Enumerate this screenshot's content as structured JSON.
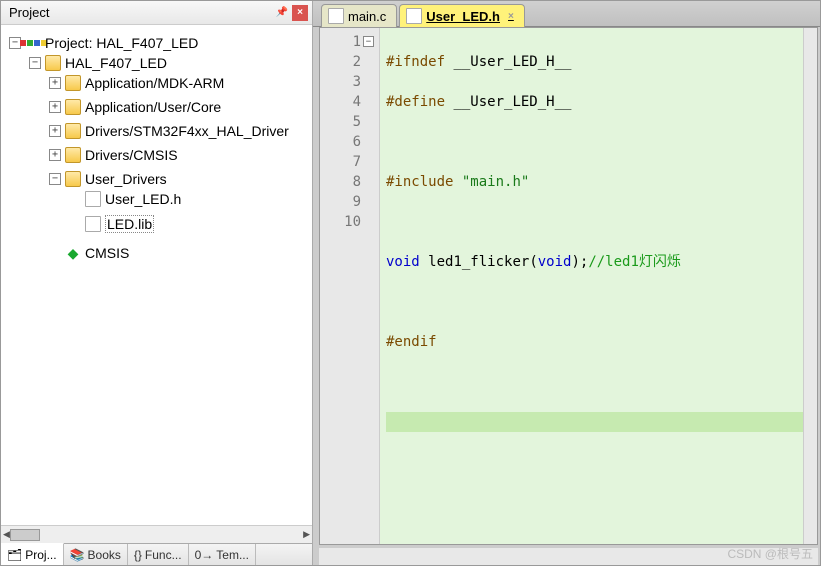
{
  "panel": {
    "title": "Project",
    "pin_icon": "pin-icon",
    "close_icon": "×"
  },
  "tree": {
    "root_label": "Project: HAL_F407_LED",
    "target_label": "HAL_F407_LED",
    "groups": {
      "g0": "Application/MDK-ARM",
      "g1": "Application/User/Core",
      "g2": "Drivers/STM32F4xx_HAL_Driver",
      "g3": "Drivers/CMSIS",
      "g4": "User_Drivers",
      "g5": "CMSIS"
    },
    "files": {
      "f0": "User_LED.h",
      "f1": "LED.lib"
    }
  },
  "bottom_tabs": {
    "t0": "Proj...",
    "t1": "Books",
    "t2": "Func...",
    "t3": "Tem..."
  },
  "editor": {
    "tabs": {
      "t0": "main.c",
      "t1": "User_LED.h"
    },
    "line_numbers": [
      "1",
      "2",
      "3",
      "4",
      "5",
      "6",
      "7",
      "8",
      "9",
      "10"
    ],
    "code": {
      "l1a": "#ifndef",
      "l1b": "__User_LED_H__",
      "l2a": "#define",
      "l2b": "__User_LED_H__",
      "l4a": "#include",
      "l4b": "\"main.h\"",
      "l6a": "void",
      "l6b": "led1_flicker",
      "l6c": "(",
      "l6d": "void",
      "l6e": ");",
      "l6f": "//led1灯闪烁",
      "l8": "#endif"
    }
  },
  "watermark": "CSDN @根号五"
}
